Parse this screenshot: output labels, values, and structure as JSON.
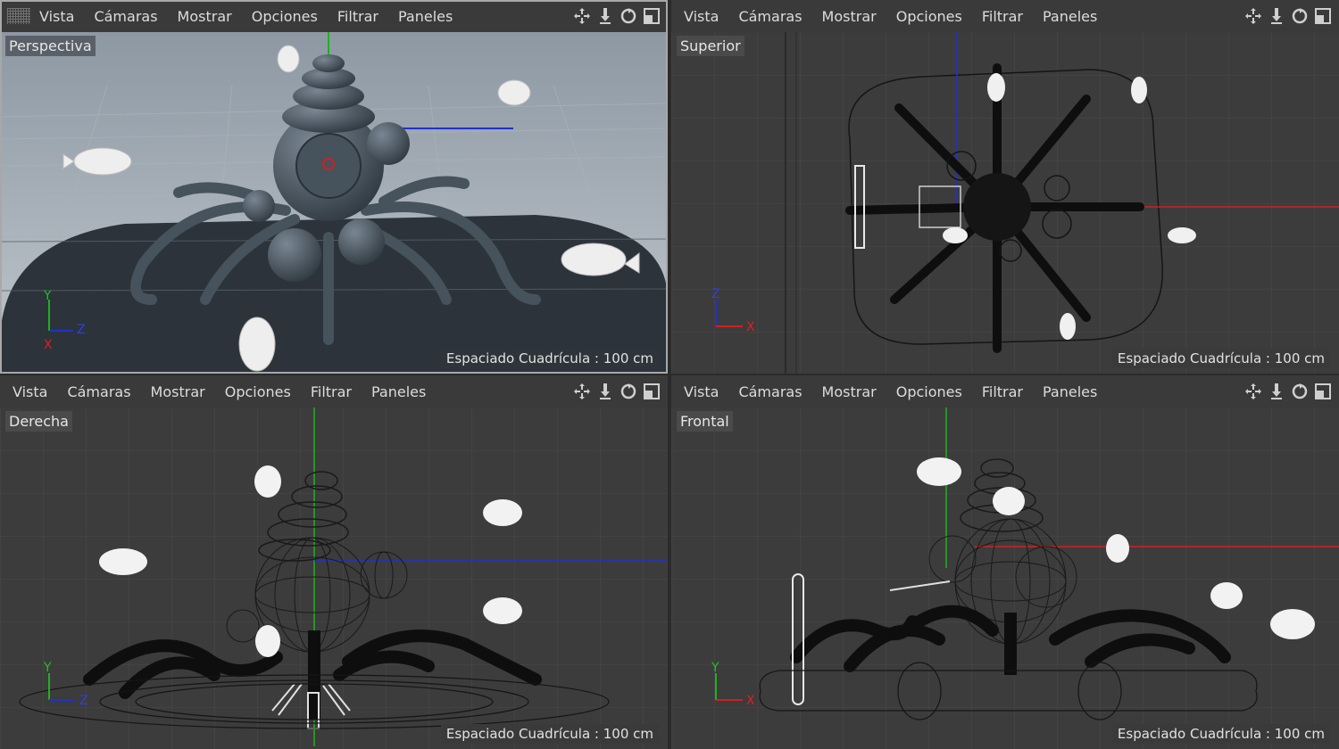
{
  "menu": {
    "items": [
      "Vista",
      "Cámaras",
      "Mostrar",
      "Opciones",
      "Filtrar",
      "Paneles"
    ]
  },
  "icons": [
    "move-icon",
    "zoom-icon",
    "rotate-icon",
    "maximize-icon"
  ],
  "viewports": [
    {
      "camera": "Perspectiva",
      "grid": "Espaciado Cuadrícula : 100 cm",
      "active": true
    },
    {
      "camera": "Superior",
      "grid": "Espaciado Cuadrícula : 100 cm",
      "active": false
    },
    {
      "camera": "Derecha",
      "grid": "Espaciado Cuadrícula : 100 cm",
      "active": false
    },
    {
      "camera": "Frontal",
      "grid": "Espaciado Cuadrícula : 100 cm",
      "active": false
    }
  ],
  "axes": {
    "perspective": [
      "Y",
      "Z",
      "X"
    ],
    "top": [
      "Z",
      "X"
    ],
    "right": [
      "Y",
      "Z"
    ],
    "front": [
      "Y",
      "X"
    ]
  },
  "colors": {
    "x_axis": "#d02020",
    "y_axis": "#20b020",
    "z_axis": "#2030d0",
    "wire": "#101010"
  }
}
